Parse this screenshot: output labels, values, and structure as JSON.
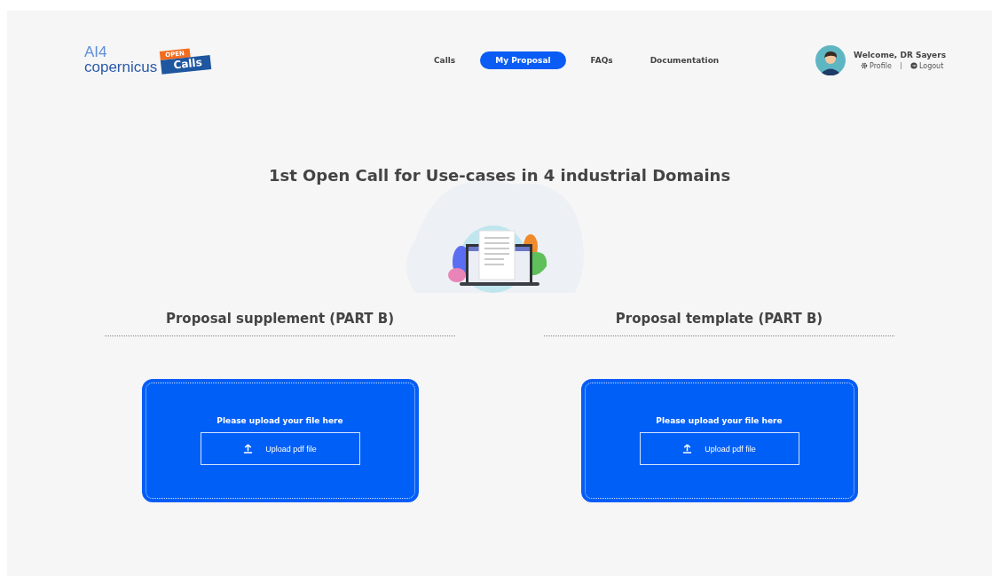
{
  "logo": {
    "brand_top": "AI4",
    "brand_bottom": "copernicus",
    "badge_top": "OPEN",
    "badge_bottom": "Calls"
  },
  "nav": [
    {
      "label": "Calls",
      "selected": false
    },
    {
      "label": "My Proposal",
      "selected": true
    },
    {
      "label": "FAQs",
      "selected": false
    },
    {
      "label": "Documentation",
      "selected": false
    }
  ],
  "user": {
    "welcome": "Welcome, DR Sayers",
    "links": [
      {
        "kind": "profile",
        "label": "Profile"
      },
      {
        "kind": "logout",
        "label": "Logout"
      }
    ]
  },
  "title": "1st Open Call for Use-cases in 4 industrial Domains",
  "sections": [
    {
      "heading": "Proposal supplement (PART B)",
      "prompt": "Please upload your file here",
      "button": "Upload pdf file"
    },
    {
      "heading": "Proposal template (PART B)",
      "prompt": "Please upload your file here",
      "button": "Upload pdf file"
    }
  ]
}
